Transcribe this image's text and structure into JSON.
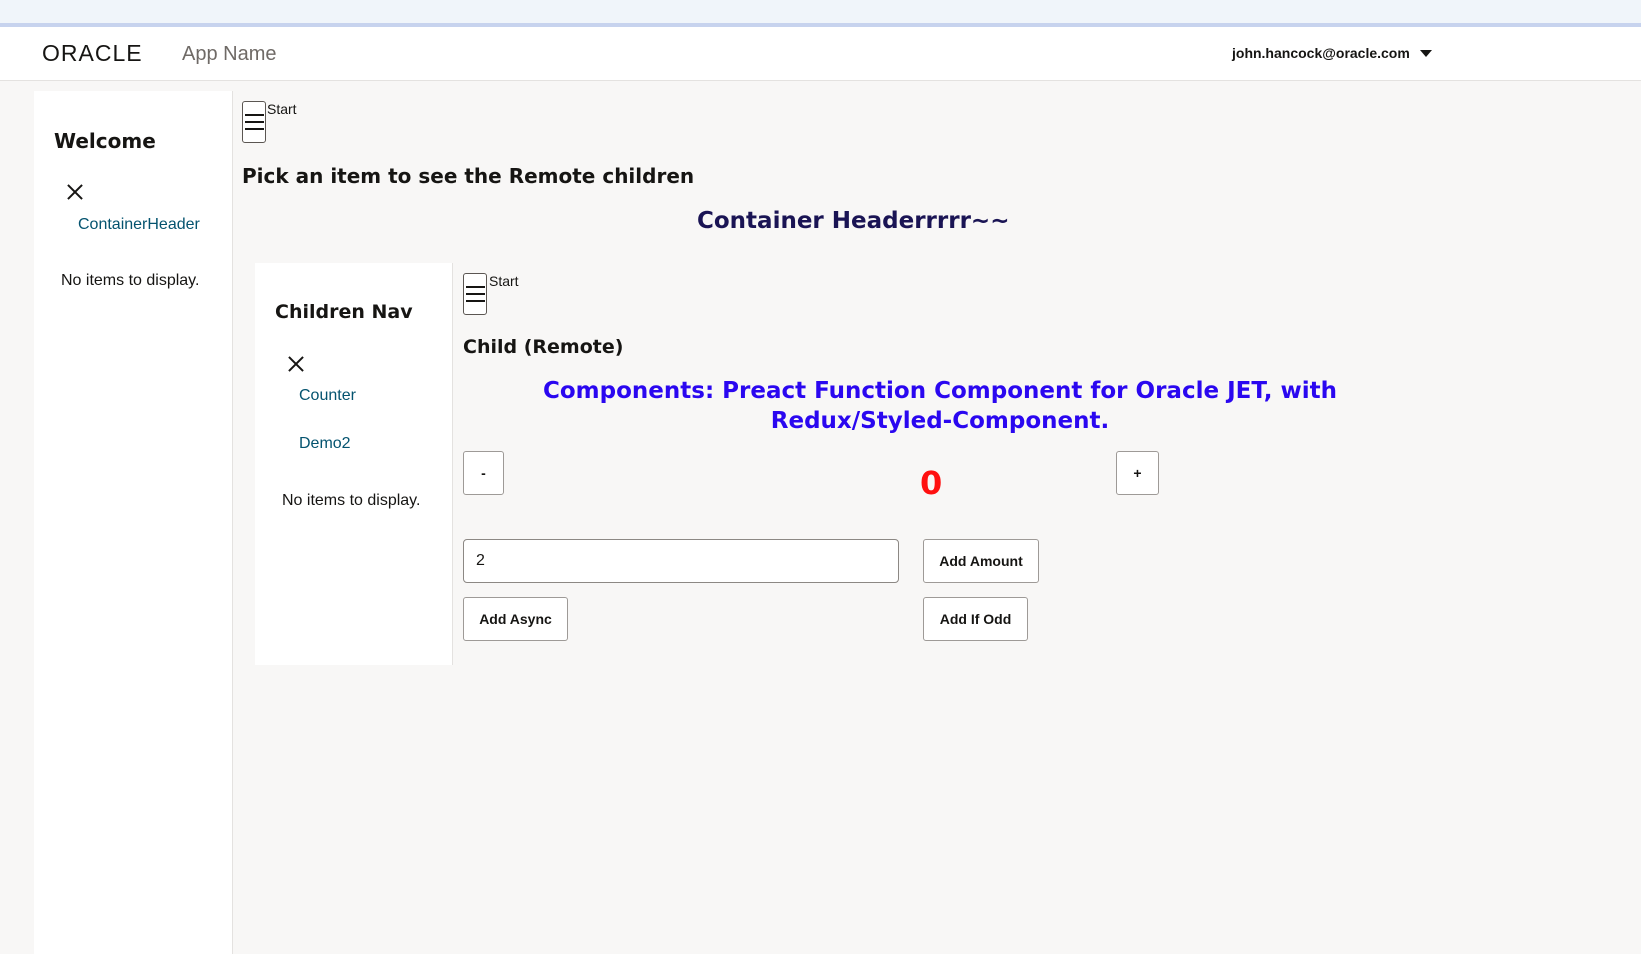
{
  "header": {
    "logo_text": "ORACLE",
    "app_name": "App Name",
    "user_email": "john.hancock@oracle.com"
  },
  "sidenav": {
    "title": "Welcome",
    "items": [
      {
        "label": "ContainerHeader"
      }
    ],
    "empty_text": "No items to display."
  },
  "main": {
    "start_label": "Start",
    "heading": "Pick an item to see the Remote children",
    "container_header": "Container Headerrrrr~~"
  },
  "children_nav": {
    "title": "Children Nav",
    "items": [
      {
        "label": "Counter"
      },
      {
        "label": "Demo2"
      }
    ],
    "empty_text": "No items to display."
  },
  "child": {
    "start_label": "Start",
    "heading": "Child (Remote)",
    "components_title": "Components: Preact Function Component for Oracle JET, with Redux/Styled-Component.",
    "decrement_label": "-",
    "increment_label": "+",
    "count": "0",
    "amount_value": "2",
    "add_amount_label": "Add Amount",
    "add_async_label": "Add Async",
    "add_if_odd_label": "Add If Odd"
  },
  "colors": {
    "container_header": "#1a1454",
    "components_title": "#2a07f0",
    "counter": "#ff1010",
    "nav_link": "#04536f"
  }
}
